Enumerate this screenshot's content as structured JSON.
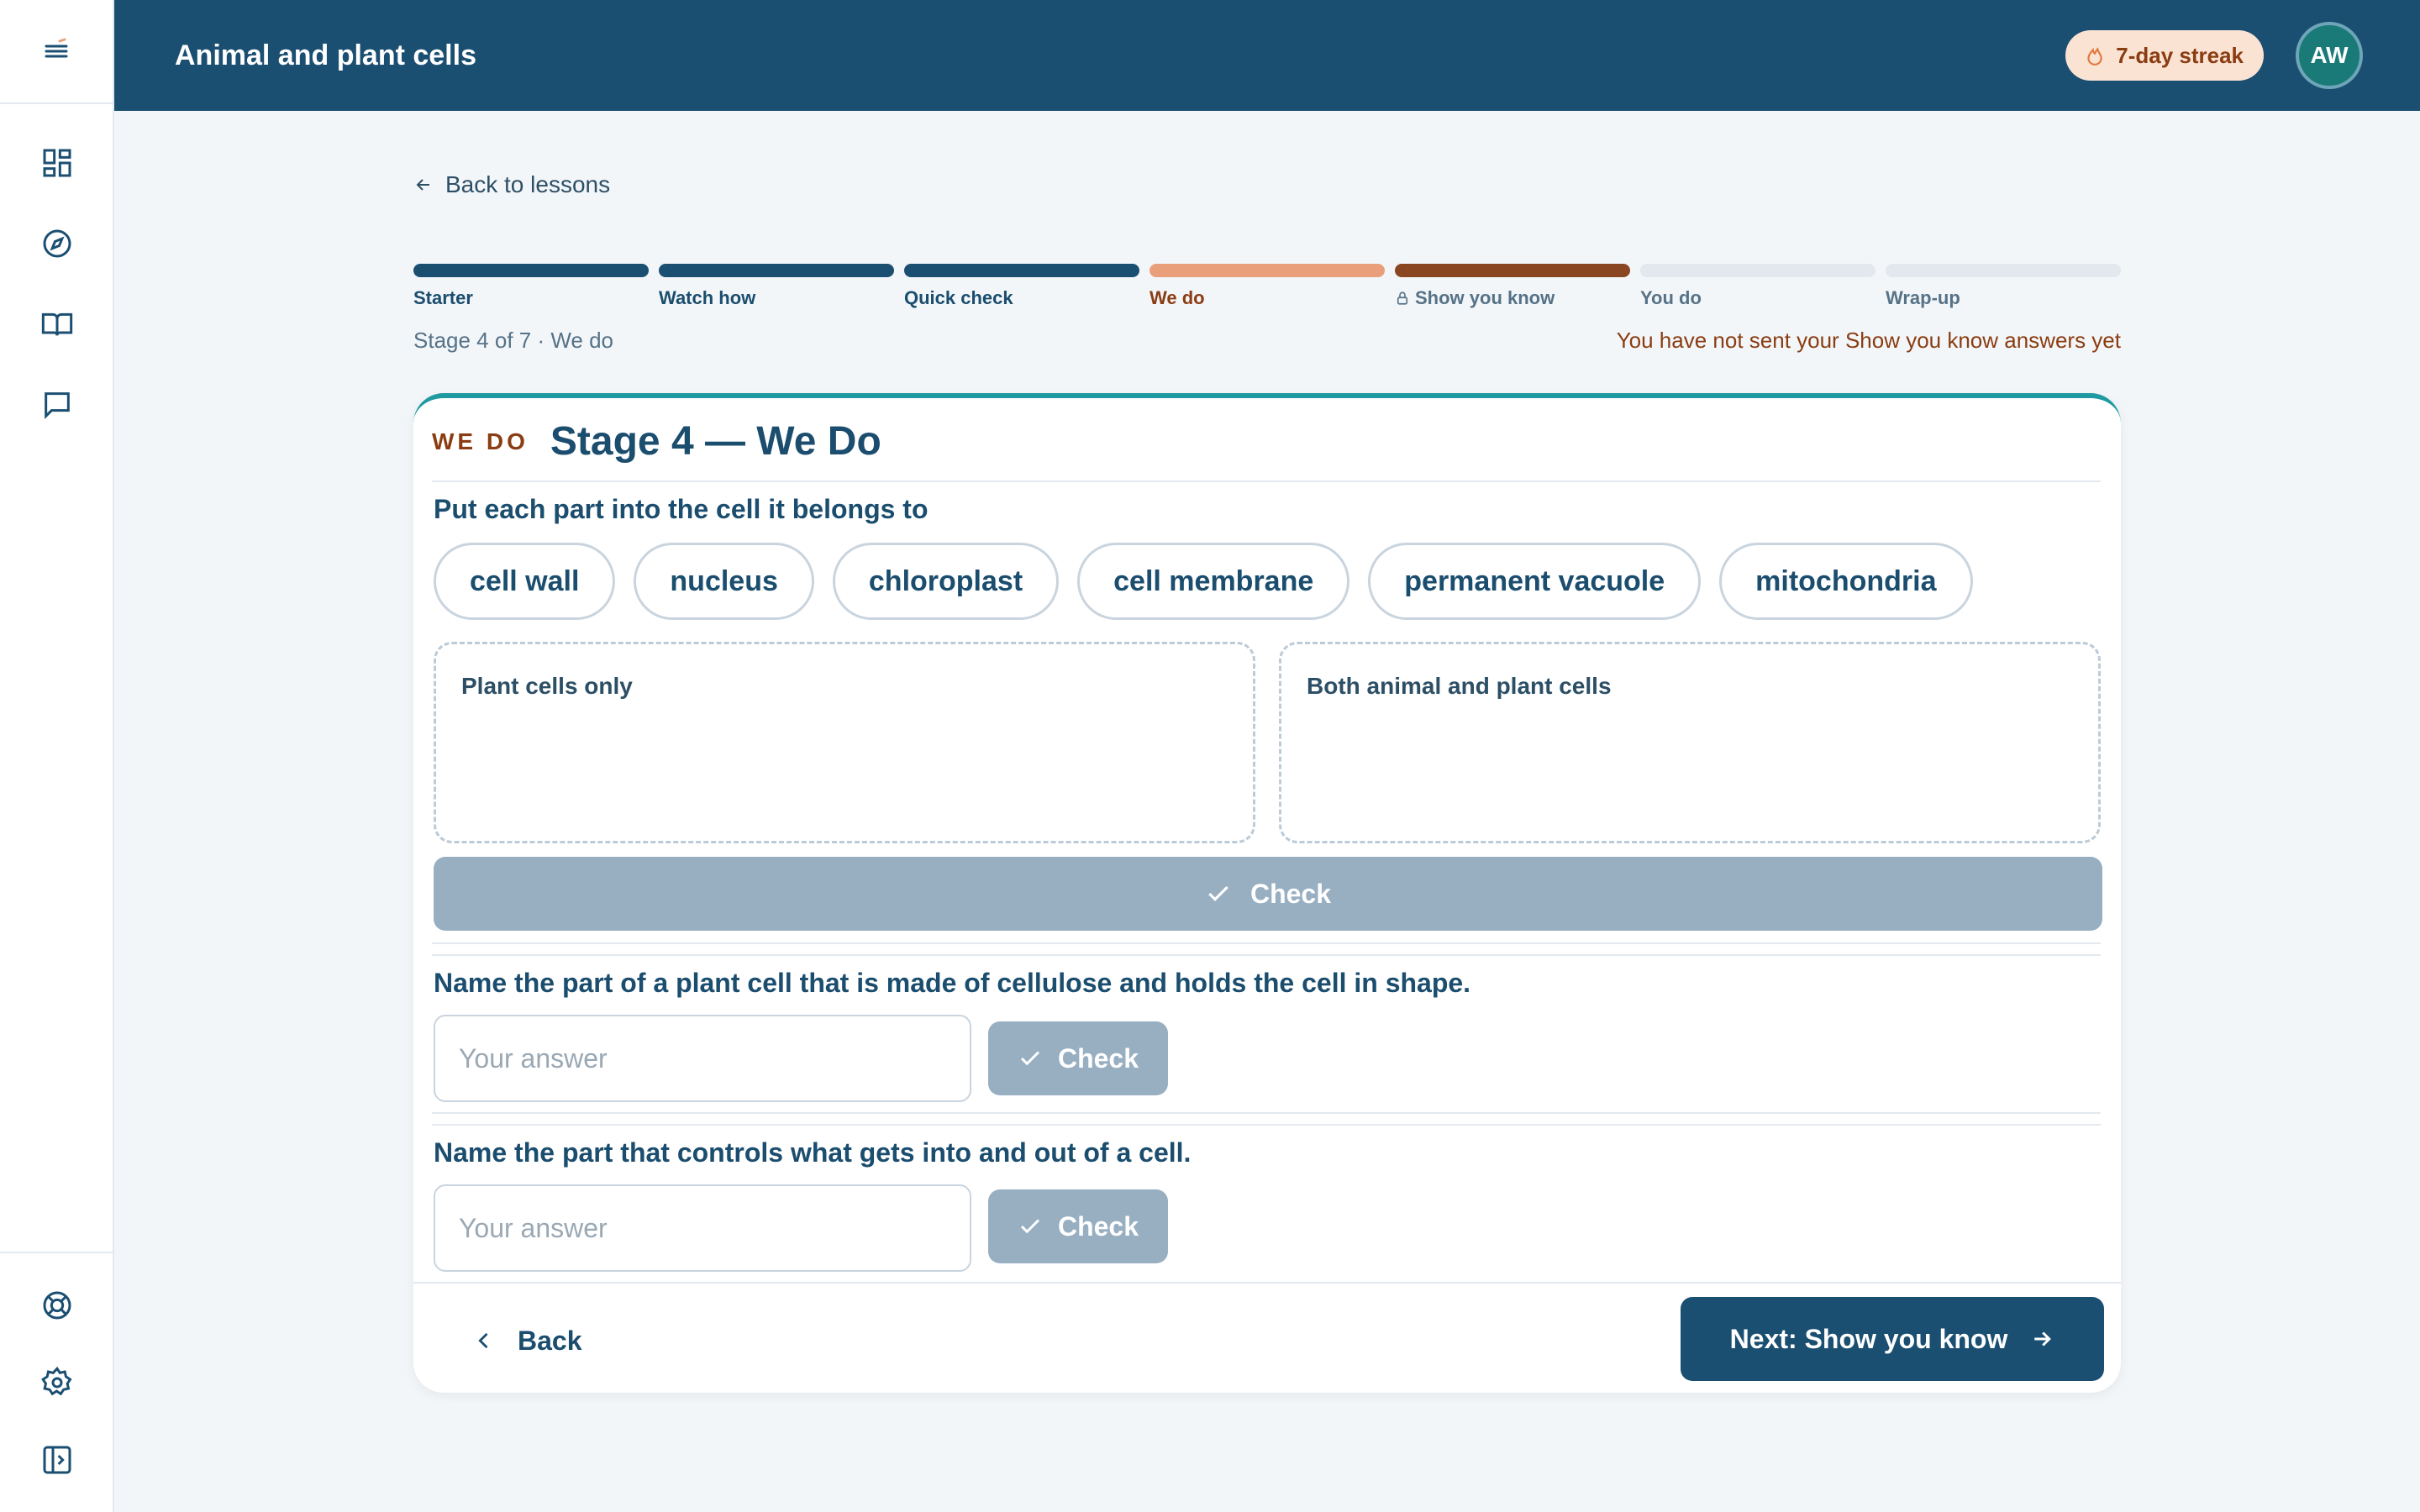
{
  "header": {
    "title": "Animal and plant cells",
    "streak": "7-day streak",
    "avatar_initials": "AW"
  },
  "sidebar": {
    "icons": [
      "menu-icon",
      "dashboard-icon",
      "compass-icon",
      "book-icon",
      "chat-icon",
      "help-icon",
      "settings-icon",
      "collapse-sidebar-icon"
    ]
  },
  "nav": {
    "back_to_lessons": "Back to lessons"
  },
  "stages": [
    {
      "label": "Starter",
      "state": "complete"
    },
    {
      "label": "Watch how",
      "state": "complete"
    },
    {
      "label": "Quick check",
      "state": "complete"
    },
    {
      "label": "We do",
      "state": "current"
    },
    {
      "label": "Show you know",
      "state": "locked-next"
    },
    {
      "label": "You do",
      "state": "upcoming"
    },
    {
      "label": "Wrap-up",
      "state": "upcoming"
    }
  ],
  "stage_info": "Stage 4 of 7 · We do",
  "stage_warning": "You have not sent your Show you know answers yet",
  "card": {
    "tag": "WE DO",
    "title": "Stage 4 — We Do",
    "sort_question": "Put each part into the cell it belongs to",
    "chips": [
      "cell wall",
      "nucleus",
      "chloroplast",
      "cell membrane",
      "permanent vacuole",
      "mitochondria"
    ],
    "zones": [
      "Plant cells only",
      "Both animal and plant cells"
    ],
    "check_label": "Check",
    "q2": "Name the part of a plant cell that is made of cellulose and holds the cell in shape.",
    "q3": "Name the part that controls what gets into and out of a cell.",
    "answer_placeholder": "Your answer",
    "back_label": "Back",
    "next_label": "Next: Show you know"
  },
  "colors": {
    "brand": "#1b4f72",
    "complete": "#1b4f72",
    "current": "#e9a07a",
    "next": "#8a4620",
    "upcoming": "#e2e8ee",
    "accent": "#1f9aa0"
  }
}
